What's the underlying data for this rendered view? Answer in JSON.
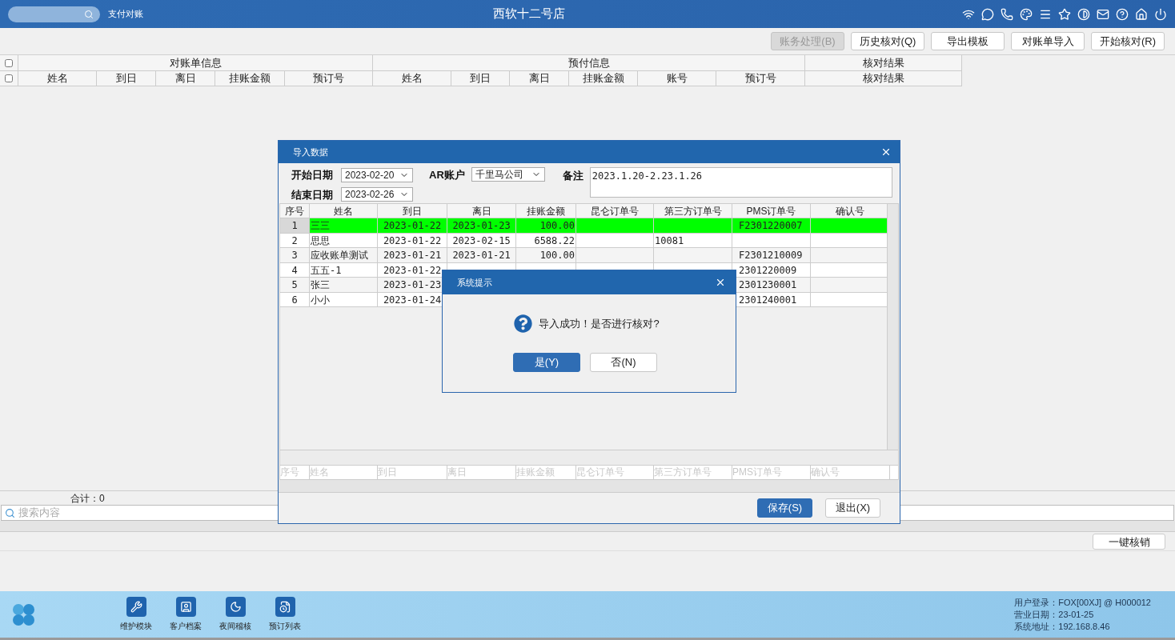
{
  "top_bar": {
    "module": "支付对账",
    "title": "西软十二号店"
  },
  "toolbar": [
    {
      "label": "账务处理(B)",
      "disabled": true
    },
    {
      "label": "历史核对(Q)",
      "disabled": false
    },
    {
      "label": "导出模板",
      "disabled": false
    },
    {
      "label": "对账单导入",
      "disabled": false
    },
    {
      "label": "开始核对(R)",
      "disabled": false
    }
  ],
  "table": {
    "select_all": [
      {
        "checked": false
      },
      {
        "checked": false
      }
    ],
    "groups": [
      {
        "label": "对账单信息",
        "columns": [
          "姓名",
          "到日",
          "离日",
          "挂账金额",
          "预订号"
        ]
      },
      {
        "label": "预付信息",
        "columns": [
          "姓名",
          "到日",
          "离日",
          "挂账金额",
          "账号",
          "预订号"
        ]
      },
      {
        "label": "核对结果",
        "columns": [
          "核对结果"
        ]
      }
    ]
  },
  "total": "合计：0",
  "search": {
    "placeholder": "搜索内容"
  },
  "action_button": "一键核销",
  "dock": {
    "items": [
      {
        "label": "维护模块"
      },
      {
        "label": "客户档案"
      },
      {
        "label": "夜间稽核"
      },
      {
        "label": "预订列表"
      }
    ],
    "status": [
      "用户登录：FOX[00XJ] @ H000012",
      "营业日期：23-01-25",
      "系统地址：192.168.8.46"
    ]
  },
  "import_dialog": {
    "title": "导入数据",
    "start_date": {
      "label": "开始日期",
      "value": "2023-02-20"
    },
    "end_date": {
      "label": "结束日期",
      "value": "2023-02-26"
    },
    "ar_account": {
      "label": "AR账户",
      "value": "千里马公司"
    },
    "note": {
      "label": "备注",
      "value": "2023.1.20-2.23.1.26"
    },
    "columns": [
      "序号",
      "姓名",
      "到日",
      "离日",
      "挂账金额",
      "昆仑订单号",
      "第三方订单号",
      "PMS订单号",
      "确认号"
    ],
    "rows": [
      {
        "cells": [
          "1",
          "三三",
          "2023-01-22",
          "2023-01-23",
          "100.00",
          "",
          "",
          "F2301220007",
          ""
        ],
        "selected": true
      },
      {
        "cells": [
          "2",
          "思思",
          "2023-01-22",
          "2023-02-15",
          "6588.22",
          "",
          "10081",
          "",
          ""
        ],
        "selected": false
      },
      {
        "cells": [
          "3",
          "应收账单测试",
          "2023-01-21",
          "2023-01-21",
          "100.00",
          "",
          "",
          "F2301210009",
          ""
        ],
        "selected": false
      },
      {
        "cells": [
          "4",
          "五五-1",
          "2023-01-22",
          "",
          "",
          "",
          "",
          "2301220009",
          ""
        ],
        "selected": false
      },
      {
        "cells": [
          "5",
          "张三",
          "2023-01-23",
          "",
          "",
          "",
          "",
          "2301230001",
          ""
        ],
        "selected": false
      },
      {
        "cells": [
          "6",
          "小小",
          "2023-01-24",
          "",
          "",
          "",
          "",
          "2301240001",
          ""
        ],
        "selected": false
      }
    ],
    "filter_row": [
      "序号",
      "姓名",
      "到日",
      "离日",
      "挂账金额",
      "昆仑订单号",
      "第三方订单号",
      "PMS订单号",
      "确认号"
    ],
    "buttons": [
      {
        "label": "保存(S)",
        "kind": "primary"
      },
      {
        "label": "退出(X)",
        "kind": "plain"
      }
    ]
  },
  "prompt": {
    "title": "系统提示",
    "message": "导入成功！是否进行核对?",
    "buttons": [
      {
        "label": "是(Y)",
        "kind": "primary"
      },
      {
        "label": "否(N)",
        "kind": "plain"
      }
    ]
  }
}
